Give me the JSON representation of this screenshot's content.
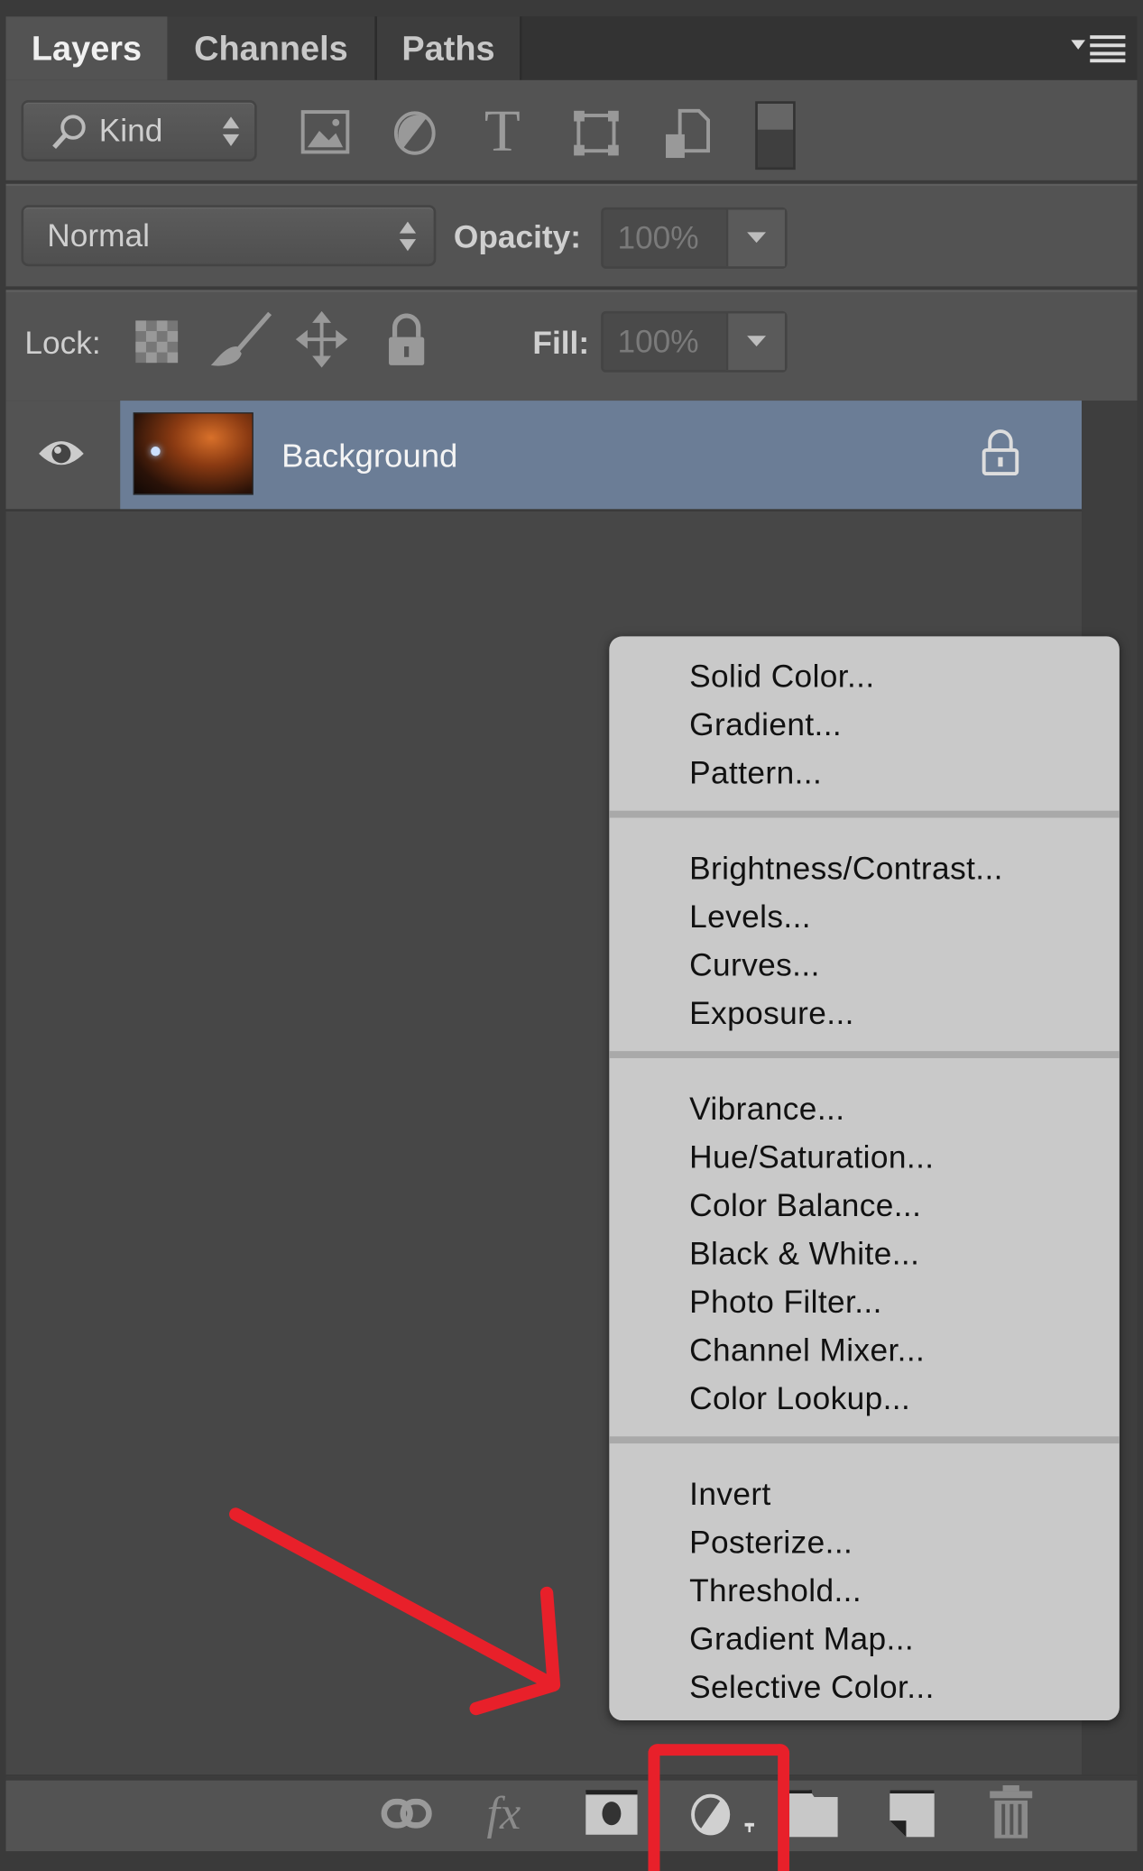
{
  "tabs": [
    {
      "label": "Layers",
      "active": true
    },
    {
      "label": "Channels"
    },
    {
      "label": "Paths"
    }
  ],
  "panel_menu_icon": "panel-menu-icon",
  "filter": {
    "kind_label": "Kind",
    "icons": [
      "image-filter-icon",
      "adjustment-filter-icon",
      "type-filter-icon",
      "shape-filter-icon",
      "smart-object-filter-icon",
      "filter-toggle-switch"
    ]
  },
  "blend": {
    "mode": "Normal",
    "opacity_label": "Opacity:",
    "opacity_value": "100%"
  },
  "lock": {
    "label": "Lock:",
    "fill_label": "Fill:",
    "fill_value": "100%",
    "icons": [
      "lock-transparent-icon",
      "lock-image-icon",
      "lock-position-icon",
      "lock-all-icon"
    ]
  },
  "layers": [
    {
      "name": "Background",
      "visible": true,
      "locked": true,
      "selected": true
    }
  ],
  "menu": {
    "groups": [
      [
        "Solid Color...",
        "Gradient...",
        "Pattern..."
      ],
      [
        "Brightness/Contrast...",
        "Levels...",
        "Curves...",
        "Exposure..."
      ],
      [
        "Vibrance...",
        "Hue/Saturation...",
        "Color Balance...",
        "Black & White...",
        "Photo Filter...",
        "Channel Mixer...",
        "Color Lookup..."
      ],
      [
        "Invert",
        "Posterize...",
        "Threshold...",
        "Gradient Map...",
        "Selective Color..."
      ]
    ]
  },
  "bottom_icons": [
    "link-layers-icon",
    "fx-icon",
    "add-mask-icon",
    "adjustment-layer-icon",
    "new-group-icon",
    "new-layer-icon",
    "trash-icon"
  ],
  "colors": {
    "selected_layer": "#6b7d96",
    "annotation": "#e8202a",
    "menu_bg": "#c9c9c9"
  }
}
